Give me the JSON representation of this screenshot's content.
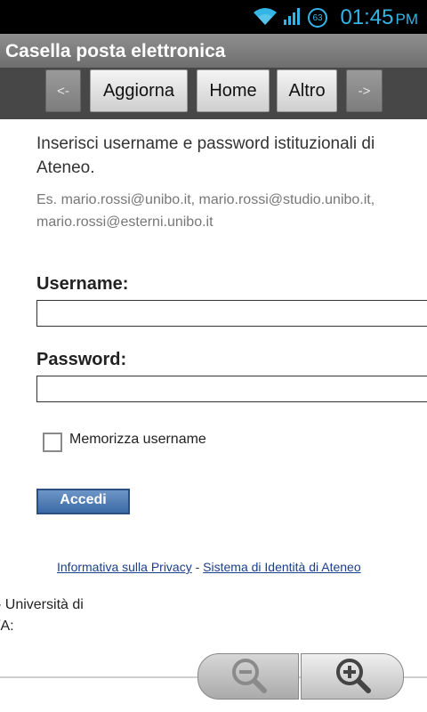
{
  "status_bar": {
    "time": "01:45",
    "ampm": "PM",
    "battery_level": "63"
  },
  "title_bar": {
    "title": "Casella posta elettronica"
  },
  "toolbar": {
    "back": "<-",
    "refresh": "Aggiorna",
    "home": "Home",
    "more": "Altro",
    "forward": "->"
  },
  "form": {
    "intro": "Inserisci username e password istituzionali di Ateneo.",
    "example": "Es. mario.rossi@unibo.it, mario.rossi@studio.unibo.it, mario.rossi@esterni.unibo.it",
    "username_label": "Username:",
    "username_value": "",
    "password_label": "Password:",
    "password_value": "",
    "remember_label": "Memorizza username",
    "submit": "Accedi"
  },
  "links": {
    "privacy": "Informativa sulla Privacy",
    "separator": "-",
    "identity": "Sistema di Identità di Ateneo"
  },
  "footer": {
    "line1": "- Università di",
    "line2": "/A:"
  }
}
